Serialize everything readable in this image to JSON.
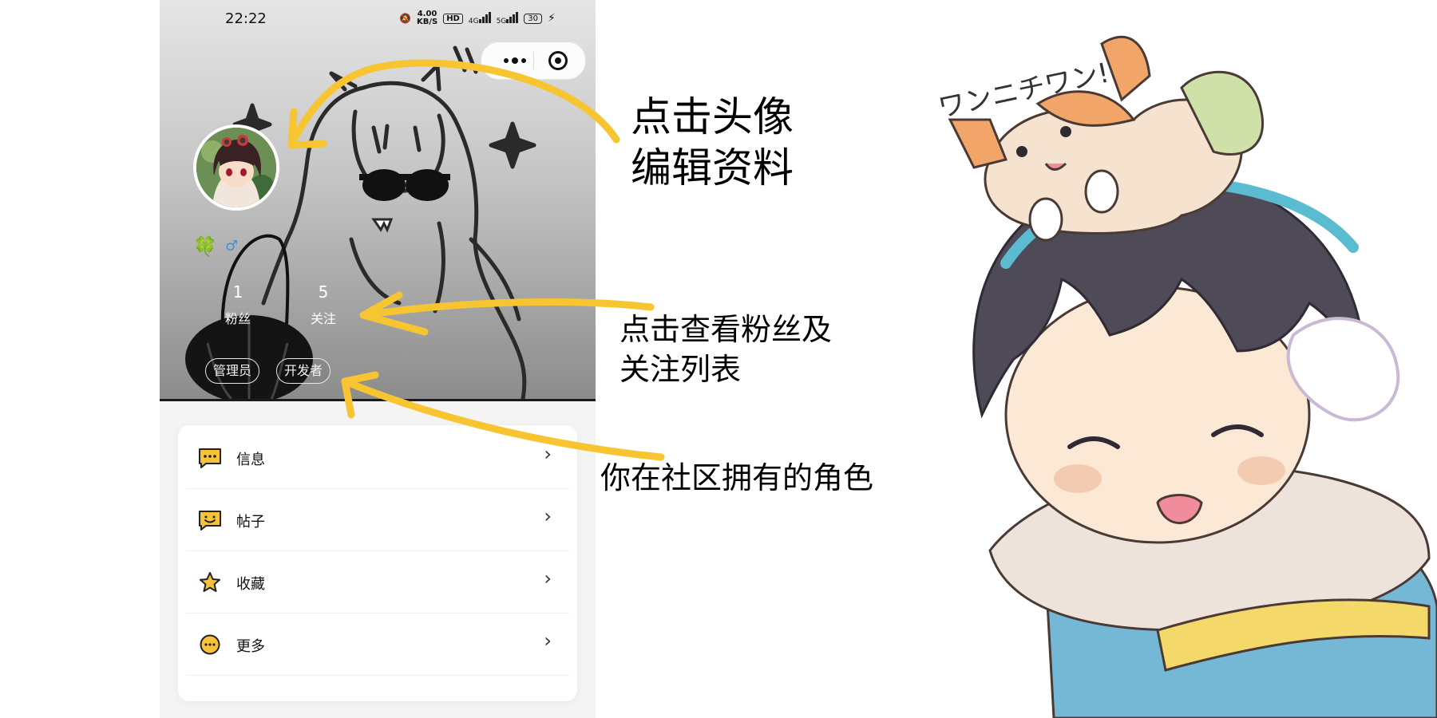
{
  "status_bar": {
    "time": "22:22",
    "speed_value": "4.00",
    "speed_unit": "KB/S",
    "hd": "HD",
    "network_4g": "4G",
    "network_5g": "5G",
    "battery": "30"
  },
  "capsule": {
    "more_icon": "more-dots-icon",
    "close_icon": "target-icon"
  },
  "profile": {
    "badge_icon": "clover-icon",
    "gender_icon": "male-icon",
    "stats": [
      {
        "value": "1",
        "label": "粉丝"
      },
      {
        "value": "5",
        "label": "关注"
      }
    ],
    "roles": [
      "管理员",
      "开发者"
    ]
  },
  "menu": {
    "items": [
      {
        "label": "信息",
        "icon": "message-icon"
      },
      {
        "label": "帖子",
        "icon": "post-icon"
      },
      {
        "label": "收藏",
        "icon": "star-icon"
      },
      {
        "label": "更多",
        "icon": "more-icon"
      }
    ]
  },
  "annotations": {
    "avatar_line1": "点击头像",
    "avatar_line2": "编辑资料",
    "follow_line1": "点击查看粉丝及",
    "follow_line2": "关注列表",
    "roles": "你在社区拥有的角色",
    "arrow_color": "#f7c531"
  },
  "mascot_text": "ワンニチワン!"
}
